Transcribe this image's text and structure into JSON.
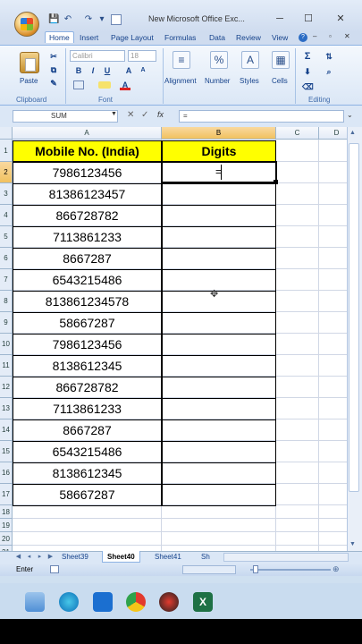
{
  "window": {
    "title": "New Microsoft Office Exc...",
    "controls": [
      "─",
      "☐",
      "✕"
    ]
  },
  "qat": [
    "💾",
    "↶",
    "↷",
    "▾"
  ],
  "ribbon": {
    "tabs": [
      "Home",
      "Insert",
      "Page Layout",
      "Formulas",
      "Data",
      "Review",
      "View"
    ],
    "groups": {
      "clipboard": "Clipboard",
      "font": "Font",
      "editing": "Editing"
    },
    "paste_label": "Paste",
    "font_name": "Calibri",
    "font_size": "18",
    "bold": "B",
    "italic": "I",
    "underline": "U",
    "alignment_label": "Alignment",
    "number_label": "Number",
    "number_symbol": "%",
    "styles_label": "Styles",
    "cells_label": "Cells",
    "sigma": "Σ"
  },
  "formula_bar": {
    "name_box": "SUM",
    "fx": "fx",
    "formula": "="
  },
  "columns": [
    "A",
    "B",
    "C",
    "D"
  ],
  "rows": [
    "1",
    "2",
    "3",
    "4",
    "5",
    "6",
    "7",
    "8",
    "9",
    "10",
    "11",
    "12",
    "13",
    "14",
    "15",
    "16",
    "17",
    "18",
    "19",
    "20",
    "21"
  ],
  "header": {
    "col_a": "Mobile No. (India)",
    "col_b": "Digits"
  },
  "active_cell_value": "=",
  "mobile_numbers": [
    "7986123456",
    "81386123457",
    "866728782",
    "7113861233",
    "8667287",
    "6543215486",
    "813861234578",
    "58667287",
    "7986123456",
    "8138612345",
    "866728782",
    "7113861233",
    "8667287",
    "6543215486",
    "8138612345",
    "58667287"
  ],
  "sheet_tabs": [
    "Sheet39",
    "Sheet40",
    "Sheet41",
    "Sh"
  ],
  "active_sheet": "Sheet40",
  "status": "Enter"
}
